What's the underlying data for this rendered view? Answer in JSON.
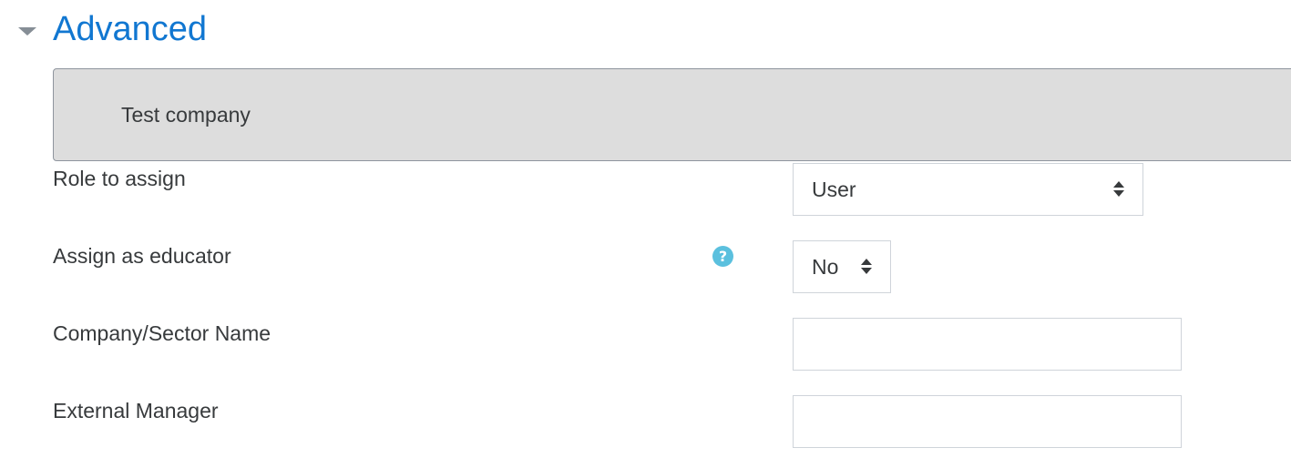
{
  "section": {
    "title": "Advanced",
    "collapse_icon": "chevron-down-icon"
  },
  "company_box": {
    "name": "Test company"
  },
  "fields": {
    "role": {
      "label": "Role to assign",
      "value": "User"
    },
    "educator": {
      "label": "Assign as educator",
      "value": "No",
      "help_icon": "question-circle-icon",
      "help_glyph": "?"
    },
    "company_sector": {
      "label": "Company/Sector Name",
      "value": "",
      "placeholder": ""
    },
    "external_manager": {
      "label": "External Manager",
      "value": "",
      "placeholder": ""
    }
  },
  "colors": {
    "title_blue": "#1177d1",
    "help_icon_bg": "#5bc0de",
    "company_box_bg": "#dddddd"
  }
}
